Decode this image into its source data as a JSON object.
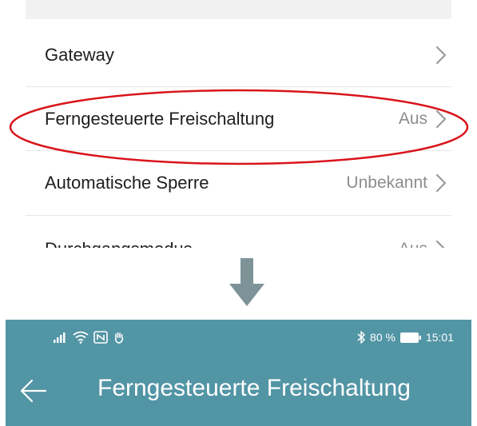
{
  "settings_list": {
    "items": [
      {
        "label": "Gateway",
        "value": ""
      },
      {
        "label": "Ferngesteuerte Freischaltung",
        "value": "Aus"
      },
      {
        "label": "Automatische Sperre",
        "value": "Unbekannt"
      },
      {
        "label": "Durchgangsmodus",
        "value": "Aus"
      }
    ]
  },
  "annotation": {
    "highlight_color": "#d9141c",
    "arrow_color": "#7d9397"
  },
  "phone": {
    "status_bar": {
      "battery": "80 %",
      "time": "15:01"
    },
    "app_bar": {
      "title": "Ferngesteuerte Freischaltung",
      "background": "#5295a5"
    }
  }
}
